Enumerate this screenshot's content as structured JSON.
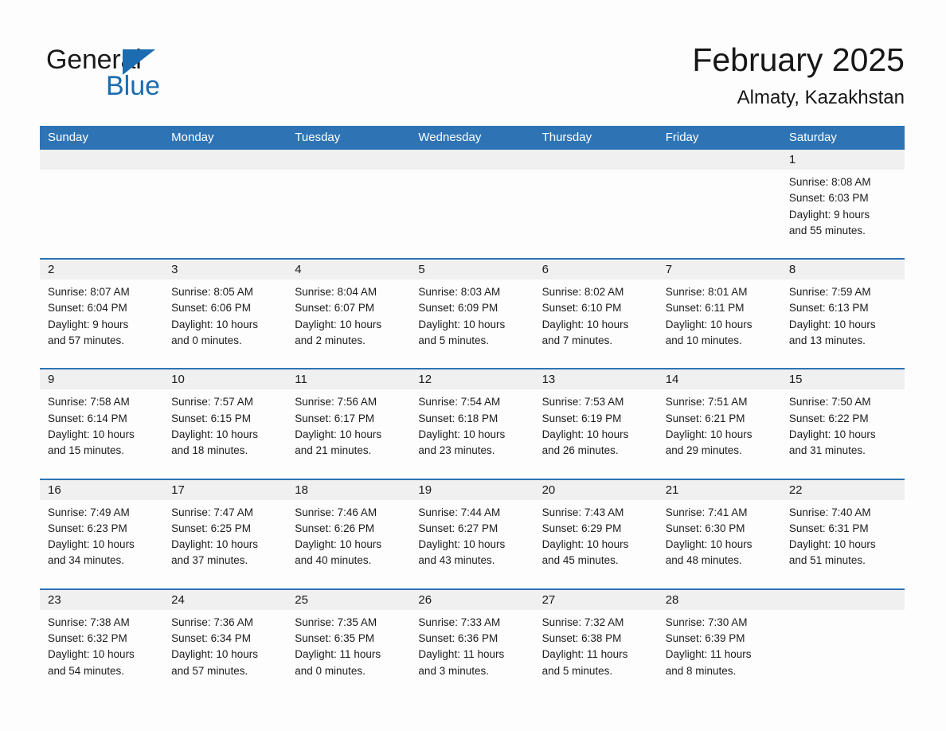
{
  "brand": {
    "name_part1": "General",
    "name_part2": "Blue",
    "accent_color": "#1b6cb0",
    "triangle_icon": "triangle-icon"
  },
  "header": {
    "title": "February 2025",
    "location": "Almaty, Kazakhstan",
    "header_bg_color": "#2e74b5"
  },
  "weekday_headers": [
    "Sunday",
    "Monday",
    "Tuesday",
    "Wednesday",
    "Thursday",
    "Friday",
    "Saturday"
  ],
  "weeks": [
    {
      "days": [
        {
          "date": "",
          "empty": true
        },
        {
          "date": "",
          "empty": true
        },
        {
          "date": "",
          "empty": true
        },
        {
          "date": "",
          "empty": true
        },
        {
          "date": "",
          "empty": true
        },
        {
          "date": "",
          "empty": true
        },
        {
          "date": "1",
          "empty": false,
          "sunrise": "Sunrise: 8:08 AM",
          "sunset": "Sunset: 6:03 PM",
          "daylight_line1": "Daylight: 9 hours",
          "daylight_line2": "and 55 minutes."
        }
      ]
    },
    {
      "days": [
        {
          "date": "2",
          "empty": false,
          "sunrise": "Sunrise: 8:07 AM",
          "sunset": "Sunset: 6:04 PM",
          "daylight_line1": "Daylight: 9 hours",
          "daylight_line2": "and 57 minutes."
        },
        {
          "date": "3",
          "empty": false,
          "sunrise": "Sunrise: 8:05 AM",
          "sunset": "Sunset: 6:06 PM",
          "daylight_line1": "Daylight: 10 hours",
          "daylight_line2": "and 0 minutes."
        },
        {
          "date": "4",
          "empty": false,
          "sunrise": "Sunrise: 8:04 AM",
          "sunset": "Sunset: 6:07 PM",
          "daylight_line1": "Daylight: 10 hours",
          "daylight_line2": "and 2 minutes."
        },
        {
          "date": "5",
          "empty": false,
          "sunrise": "Sunrise: 8:03 AM",
          "sunset": "Sunset: 6:09 PM",
          "daylight_line1": "Daylight: 10 hours",
          "daylight_line2": "and 5 minutes."
        },
        {
          "date": "6",
          "empty": false,
          "sunrise": "Sunrise: 8:02 AM",
          "sunset": "Sunset: 6:10 PM",
          "daylight_line1": "Daylight: 10 hours",
          "daylight_line2": "and 7 minutes."
        },
        {
          "date": "7",
          "empty": false,
          "sunrise": "Sunrise: 8:01 AM",
          "sunset": "Sunset: 6:11 PM",
          "daylight_line1": "Daylight: 10 hours",
          "daylight_line2": "and 10 minutes."
        },
        {
          "date": "8",
          "empty": false,
          "sunrise": "Sunrise: 7:59 AM",
          "sunset": "Sunset: 6:13 PM",
          "daylight_line1": "Daylight: 10 hours",
          "daylight_line2": "and 13 minutes."
        }
      ]
    },
    {
      "days": [
        {
          "date": "9",
          "empty": false,
          "sunrise": "Sunrise: 7:58 AM",
          "sunset": "Sunset: 6:14 PM",
          "daylight_line1": "Daylight: 10 hours",
          "daylight_line2": "and 15 minutes."
        },
        {
          "date": "10",
          "empty": false,
          "sunrise": "Sunrise: 7:57 AM",
          "sunset": "Sunset: 6:15 PM",
          "daylight_line1": "Daylight: 10 hours",
          "daylight_line2": "and 18 minutes."
        },
        {
          "date": "11",
          "empty": false,
          "sunrise": "Sunrise: 7:56 AM",
          "sunset": "Sunset: 6:17 PM",
          "daylight_line1": "Daylight: 10 hours",
          "daylight_line2": "and 21 minutes."
        },
        {
          "date": "12",
          "empty": false,
          "sunrise": "Sunrise: 7:54 AM",
          "sunset": "Sunset: 6:18 PM",
          "daylight_line1": "Daylight: 10 hours",
          "daylight_line2": "and 23 minutes."
        },
        {
          "date": "13",
          "empty": false,
          "sunrise": "Sunrise: 7:53 AM",
          "sunset": "Sunset: 6:19 PM",
          "daylight_line1": "Daylight: 10 hours",
          "daylight_line2": "and 26 minutes."
        },
        {
          "date": "14",
          "empty": false,
          "sunrise": "Sunrise: 7:51 AM",
          "sunset": "Sunset: 6:21 PM",
          "daylight_line1": "Daylight: 10 hours",
          "daylight_line2": "and 29 minutes."
        },
        {
          "date": "15",
          "empty": false,
          "sunrise": "Sunrise: 7:50 AM",
          "sunset": "Sunset: 6:22 PM",
          "daylight_line1": "Daylight: 10 hours",
          "daylight_line2": "and 31 minutes."
        }
      ]
    },
    {
      "days": [
        {
          "date": "16",
          "empty": false,
          "sunrise": "Sunrise: 7:49 AM",
          "sunset": "Sunset: 6:23 PM",
          "daylight_line1": "Daylight: 10 hours",
          "daylight_line2": "and 34 minutes."
        },
        {
          "date": "17",
          "empty": false,
          "sunrise": "Sunrise: 7:47 AM",
          "sunset": "Sunset: 6:25 PM",
          "daylight_line1": "Daylight: 10 hours",
          "daylight_line2": "and 37 minutes."
        },
        {
          "date": "18",
          "empty": false,
          "sunrise": "Sunrise: 7:46 AM",
          "sunset": "Sunset: 6:26 PM",
          "daylight_line1": "Daylight: 10 hours",
          "daylight_line2": "and 40 minutes."
        },
        {
          "date": "19",
          "empty": false,
          "sunrise": "Sunrise: 7:44 AM",
          "sunset": "Sunset: 6:27 PM",
          "daylight_line1": "Daylight: 10 hours",
          "daylight_line2": "and 43 minutes."
        },
        {
          "date": "20",
          "empty": false,
          "sunrise": "Sunrise: 7:43 AM",
          "sunset": "Sunset: 6:29 PM",
          "daylight_line1": "Daylight: 10 hours",
          "daylight_line2": "and 45 minutes."
        },
        {
          "date": "21",
          "empty": false,
          "sunrise": "Sunrise: 7:41 AM",
          "sunset": "Sunset: 6:30 PM",
          "daylight_line1": "Daylight: 10 hours",
          "daylight_line2": "and 48 minutes."
        },
        {
          "date": "22",
          "empty": false,
          "sunrise": "Sunrise: 7:40 AM",
          "sunset": "Sunset: 6:31 PM",
          "daylight_line1": "Daylight: 10 hours",
          "daylight_line2": "and 51 minutes."
        }
      ]
    },
    {
      "days": [
        {
          "date": "23",
          "empty": false,
          "sunrise": "Sunrise: 7:38 AM",
          "sunset": "Sunset: 6:32 PM",
          "daylight_line1": "Daylight: 10 hours",
          "daylight_line2": "and 54 minutes."
        },
        {
          "date": "24",
          "empty": false,
          "sunrise": "Sunrise: 7:36 AM",
          "sunset": "Sunset: 6:34 PM",
          "daylight_line1": "Daylight: 10 hours",
          "daylight_line2": "and 57 minutes."
        },
        {
          "date": "25",
          "empty": false,
          "sunrise": "Sunrise: 7:35 AM",
          "sunset": "Sunset: 6:35 PM",
          "daylight_line1": "Daylight: 11 hours",
          "daylight_line2": "and 0 minutes."
        },
        {
          "date": "26",
          "empty": false,
          "sunrise": "Sunrise: 7:33 AM",
          "sunset": "Sunset: 6:36 PM",
          "daylight_line1": "Daylight: 11 hours",
          "daylight_line2": "and 3 minutes."
        },
        {
          "date": "27",
          "empty": false,
          "sunrise": "Sunrise: 7:32 AM",
          "sunset": "Sunset: 6:38 PM",
          "daylight_line1": "Daylight: 11 hours",
          "daylight_line2": "and 5 minutes."
        },
        {
          "date": "28",
          "empty": false,
          "sunrise": "Sunrise: 7:30 AM",
          "sunset": "Sunset: 6:39 PM",
          "daylight_line1": "Daylight: 11 hours",
          "daylight_line2": "and 8 minutes."
        },
        {
          "date": "",
          "empty": true
        }
      ]
    }
  ]
}
